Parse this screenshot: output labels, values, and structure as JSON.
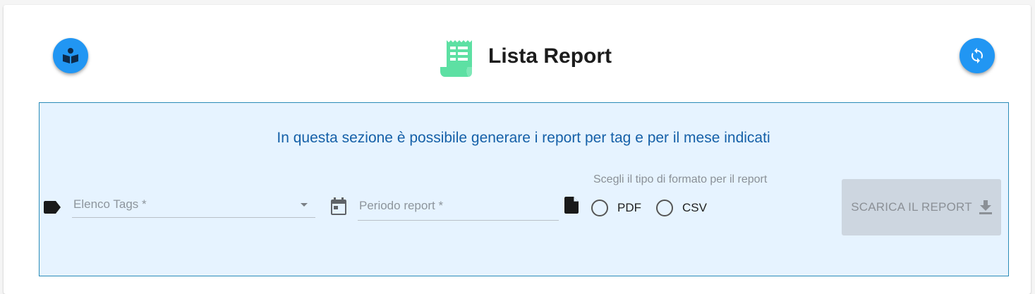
{
  "header": {
    "title": "Lista Report",
    "left_button_icon": "book-reader-icon",
    "right_button_icon": "refresh-icon",
    "title_icon": "receipt-icon"
  },
  "panel": {
    "intro_text": "In questa sezione è possibile generare i report per tag e per il mese indicati",
    "tags_field": {
      "placeholder": "Elenco Tags *",
      "value": ""
    },
    "period_field": {
      "placeholder": "Periodo report *",
      "value": ""
    },
    "format": {
      "label": "Scegli il tipo di formato per il report",
      "options": [
        "PDF",
        "CSV"
      ],
      "selected": null
    },
    "download_button": {
      "label": "SCARICA IL REPORT",
      "enabled": false
    }
  },
  "colors": {
    "accent": "#2196f3",
    "title_icon": "#5de0a3",
    "panel_bg": "#e6f3ff",
    "panel_border": "#2a8bb8",
    "intro_text": "#1560a8"
  }
}
